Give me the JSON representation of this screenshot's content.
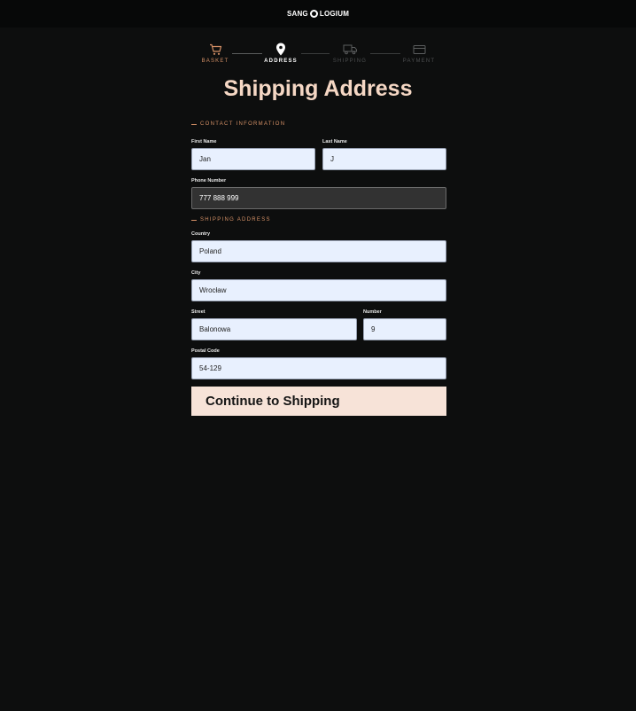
{
  "header": {
    "brand_left": "SANG",
    "brand_right": "LOGIUM"
  },
  "steps": [
    {
      "label": "BASKET",
      "state": "done",
      "icon": "cart-icon"
    },
    {
      "label": "ADDRESS",
      "state": "active",
      "icon": "location-pin-icon"
    },
    {
      "label": "SHIPPING",
      "state": "todo",
      "icon": "truck-icon"
    },
    {
      "label": "PAYMENT",
      "state": "todo",
      "icon": "card-icon"
    }
  ],
  "page_title": "Shipping Address",
  "contact": {
    "heading": "CONTACT INFORMATION",
    "first_name_label": "First Name",
    "first_name_value": "Jan",
    "last_name_label": "Last Name",
    "last_name_value": "J",
    "phone_label": "Phone Number",
    "phone_value": "777 888 999"
  },
  "shipping": {
    "heading": "SHIPPING ADDRESS",
    "country_label": "Country",
    "country_value": "Poland",
    "city_label": "City",
    "city_value": "Wrocław",
    "street_label": "Street",
    "street_value": "Balonowa",
    "number_label": "Number",
    "number_value": "9",
    "postal_label": "Postal Code",
    "postal_value": "54-129"
  },
  "continue_label": "Continue to Shipping",
  "colors": {
    "background": "#0d0e0e",
    "accent": "#d49066",
    "title": "#f5d7c4",
    "button": "#f7e3d8"
  }
}
